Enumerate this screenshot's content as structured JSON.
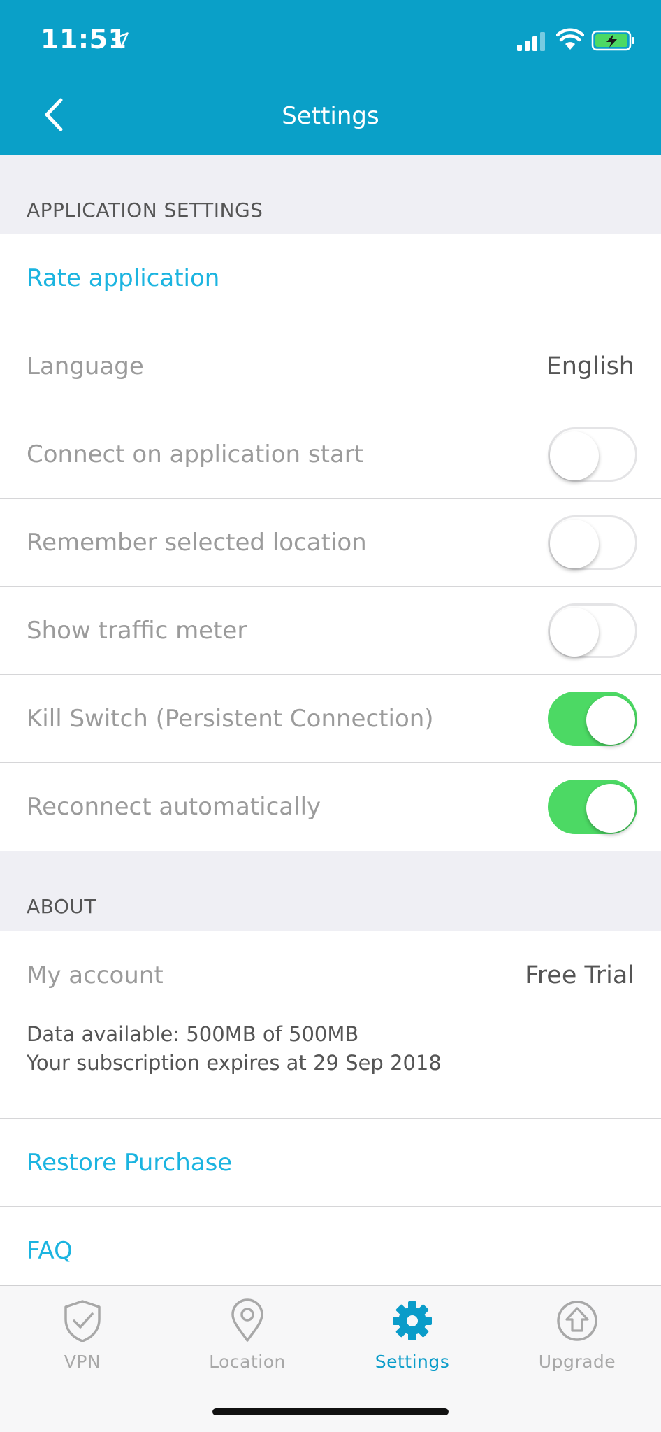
{
  "status_bar": {
    "time": "11:51"
  },
  "header": {
    "title": "Settings"
  },
  "sections": {
    "application": {
      "title": "APPLICATION SETTINGS",
      "rate_label": "Rate application",
      "language_label": "Language",
      "language_value": "English",
      "connect_start_label": "Connect on application start",
      "connect_start_on": false,
      "remember_location_label": "Remember selected location",
      "remember_location_on": false,
      "traffic_meter_label": "Show traffic meter",
      "traffic_meter_on": false,
      "kill_switch_label": "Kill Switch (Persistent Connection)",
      "kill_switch_on": true,
      "reconnect_label": "Reconnect automatically",
      "reconnect_on": true
    },
    "about": {
      "title": "ABOUT",
      "account_label": "My account",
      "account_value": "Free Trial",
      "data_available": "Data available: 500MB of 500MB",
      "subscription": "Your subscription expires at 29 Sep 2018",
      "restore_label": "Restore Purchase",
      "faq_label": "FAQ"
    }
  },
  "tabbar": {
    "tabs": [
      {
        "label": "VPN",
        "icon": "shield-check-icon",
        "active": false
      },
      {
        "label": "Location",
        "icon": "map-pin-icon",
        "active": false
      },
      {
        "label": "Settings",
        "icon": "gear-icon",
        "active": true
      },
      {
        "label": "Upgrade",
        "icon": "upload-circle-icon",
        "active": false
      }
    ]
  },
  "colors": {
    "header": "#0aa0c8",
    "link": "#1bb4e0",
    "toggle_on": "#4cd964",
    "tab_active": "#0a9cc9",
    "tab_inactive": "#a8a8a8"
  }
}
